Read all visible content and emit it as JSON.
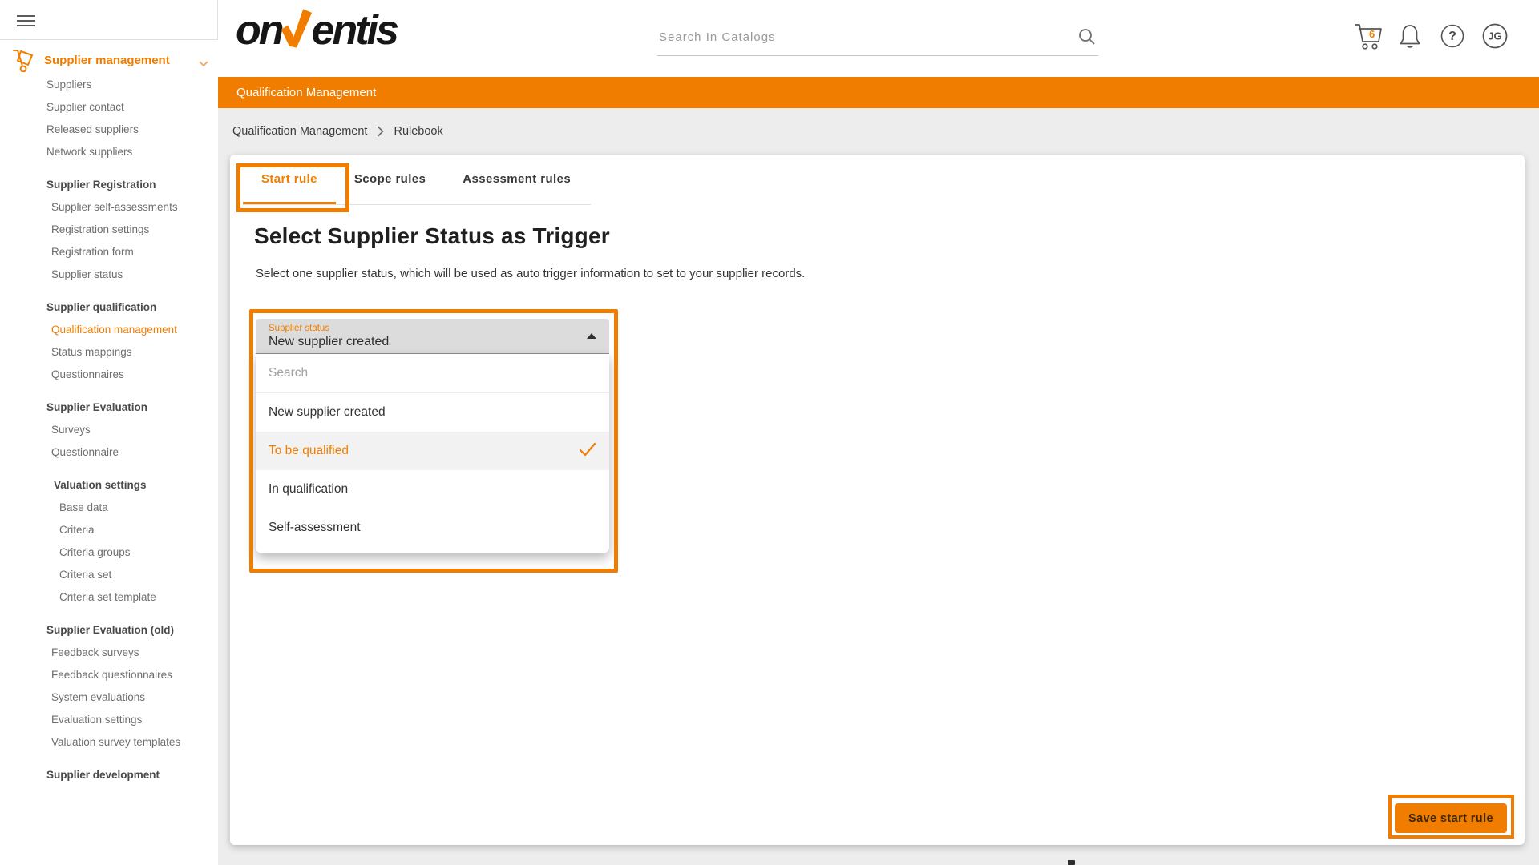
{
  "colors": {
    "accent": "#F07D00"
  },
  "header": {
    "logo_part1": "on",
    "logo_part2": "entis",
    "search_placeholder": "Search In Catalogs",
    "cart_badge": "6",
    "help_glyph": "?",
    "avatar_initials": "JG"
  },
  "banner": {
    "title": "Qualification Management"
  },
  "breadcrumb": {
    "items": [
      "Qualification Management",
      "Rulebook"
    ]
  },
  "tabs": [
    {
      "label": "Start rule"
    },
    {
      "label": "Scope rules"
    },
    {
      "label": "Assessment rules"
    }
  ],
  "main": {
    "heading": "Select Supplier Status as Trigger",
    "description": "Select one supplier status, which will be used as auto trigger information to set to your supplier records.",
    "dropdown": {
      "label": "Supplier status",
      "value": "New supplier created",
      "search_placeholder": "Search",
      "options": [
        {
          "label": "New supplier created"
        },
        {
          "label": "To be qualified"
        },
        {
          "label": "In qualification"
        },
        {
          "label": "Self-assessment"
        }
      ]
    },
    "save_button": "Save start rule"
  },
  "sidebar": {
    "items": [
      {
        "label": "Supplier management"
      },
      {
        "label": "Suppliers"
      },
      {
        "label": "Supplier contact"
      },
      {
        "label": "Released suppliers"
      },
      {
        "label": "Network suppliers"
      },
      {
        "label": "Supplier Registration"
      },
      {
        "label": "Supplier self-assessments"
      },
      {
        "label": "Registration settings"
      },
      {
        "label": "Registration form"
      },
      {
        "label": "Supplier status"
      },
      {
        "label": "Supplier qualification"
      },
      {
        "label": "Qualification management"
      },
      {
        "label": "Status mappings"
      },
      {
        "label": "Questionnaires"
      },
      {
        "label": "Supplier Evaluation"
      },
      {
        "label": "Surveys"
      },
      {
        "label": "Questionnaire"
      },
      {
        "label": "Valuation settings"
      },
      {
        "label": "Base data"
      },
      {
        "label": "Criteria"
      },
      {
        "label": "Criteria groups"
      },
      {
        "label": "Criteria set"
      },
      {
        "label": "Criteria set template"
      },
      {
        "label": "Supplier Evaluation (old)"
      },
      {
        "label": "Feedback surveys"
      },
      {
        "label": "Feedback questionnaires"
      },
      {
        "label": "System evaluations"
      },
      {
        "label": "Evaluation settings"
      },
      {
        "label": "Valuation survey templates"
      },
      {
        "label": "Supplier development"
      }
    ]
  }
}
